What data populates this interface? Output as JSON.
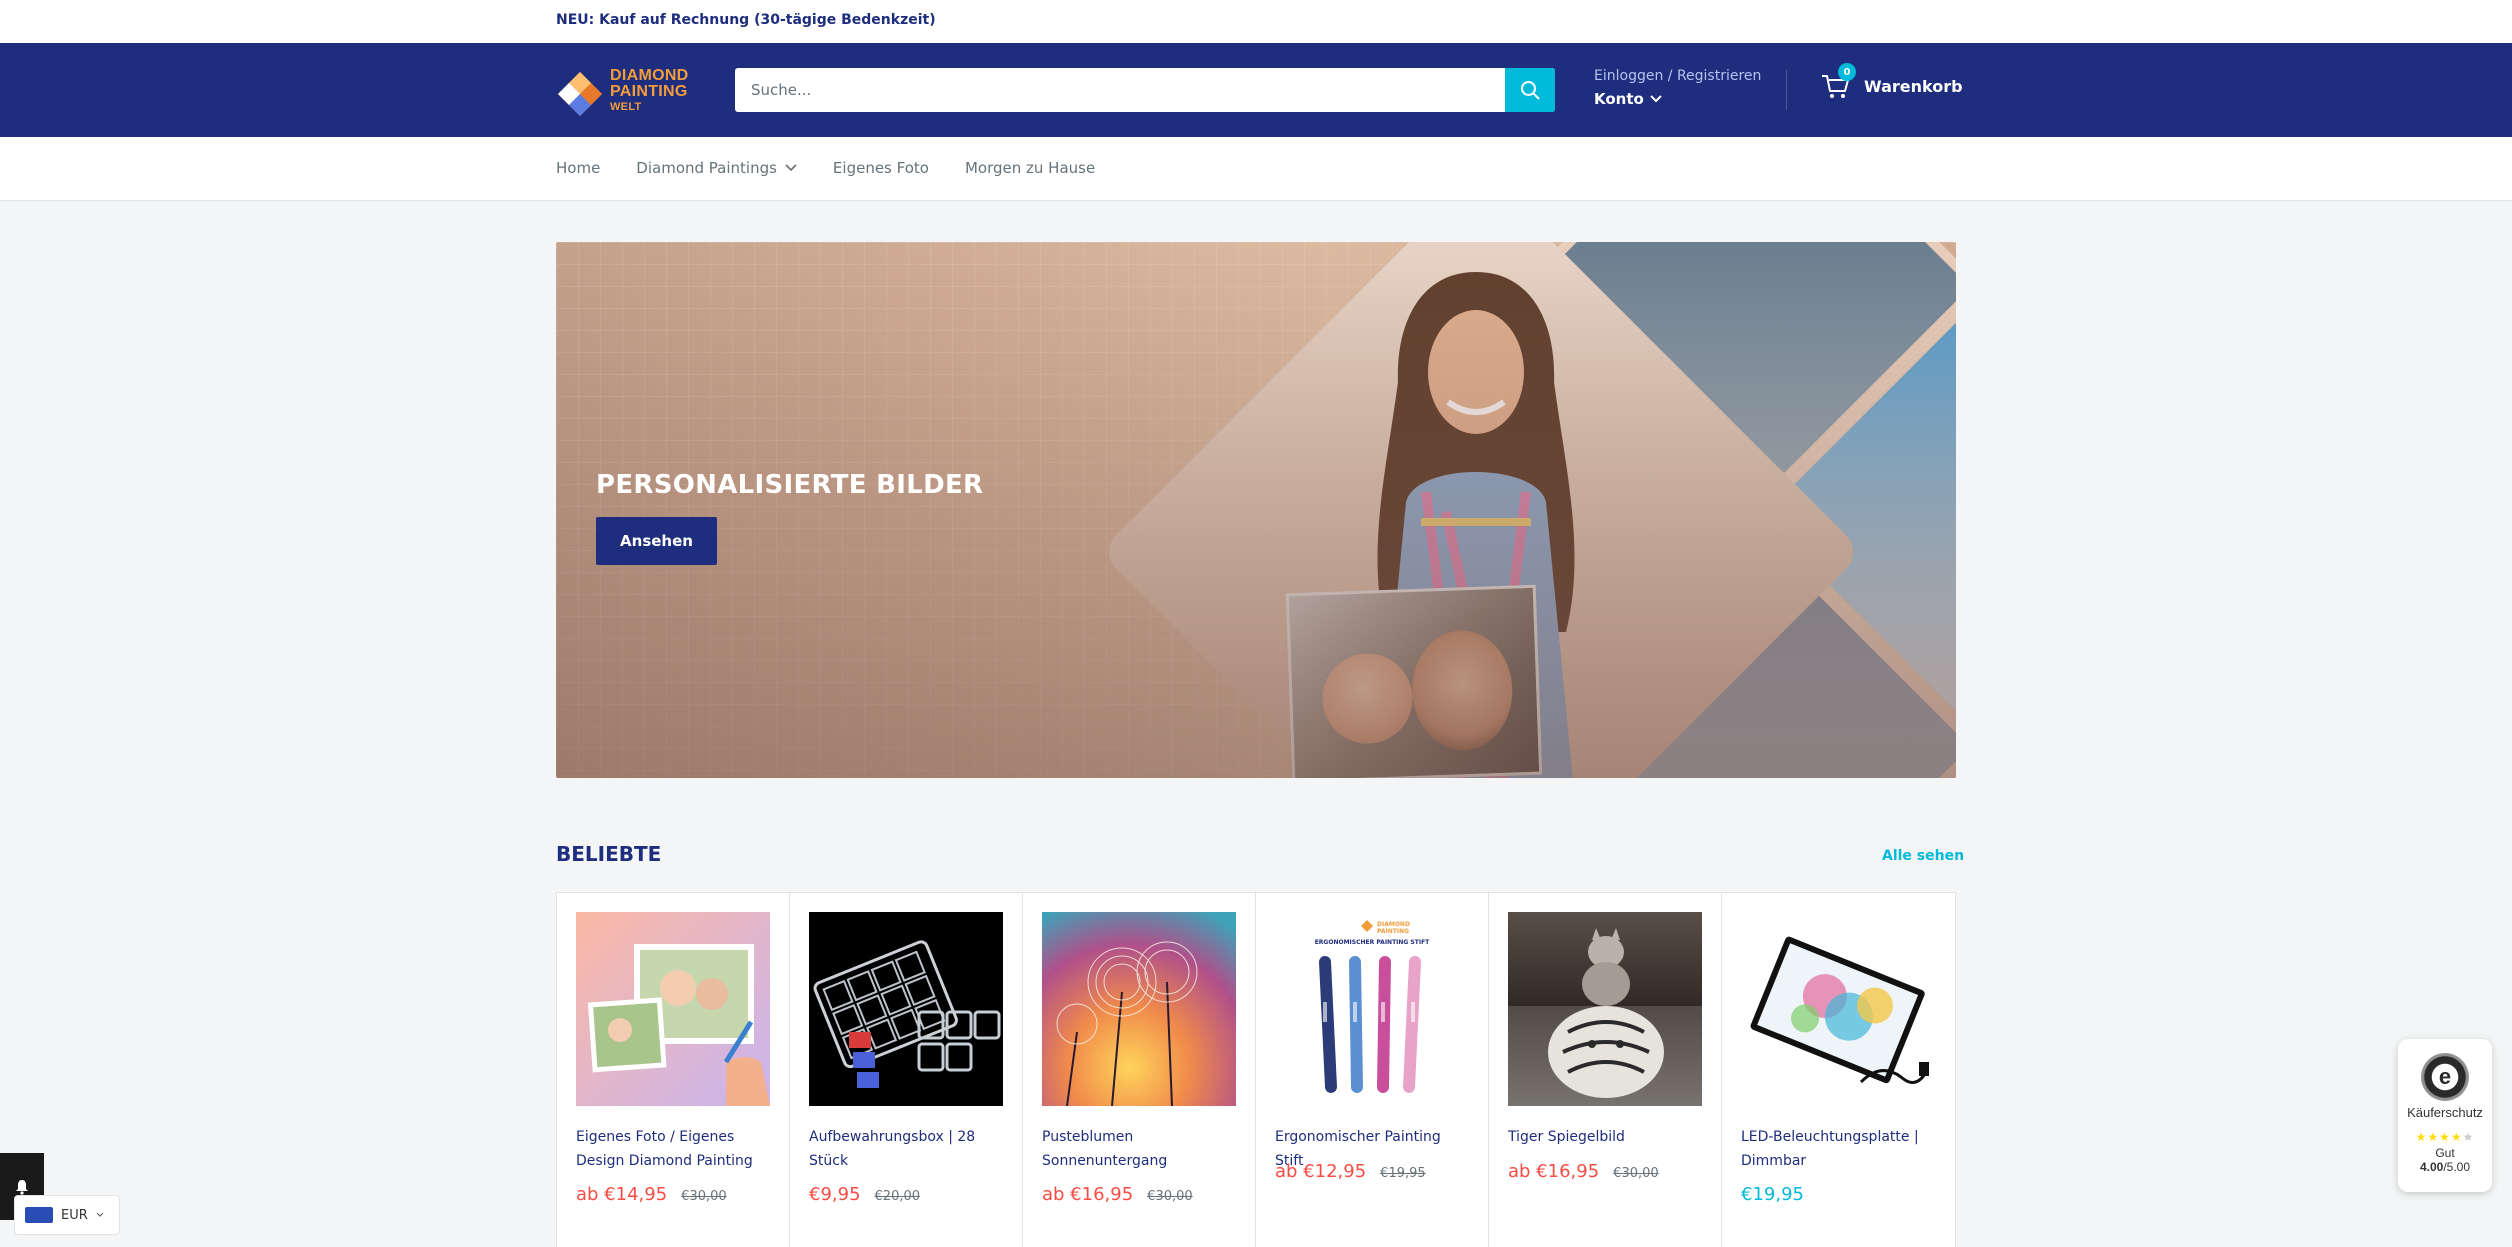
{
  "announcement": {
    "text": "NEU: Kauf auf Rechnung (30-tägige Bedenkzeit)"
  },
  "header": {
    "logo_line1": "DIAMOND",
    "logo_line2": "PAINTING",
    "logo_line3": "WELT",
    "search_placeholder": "Suche...",
    "account_link": "Einloggen / Registrieren",
    "account_label": "Konto",
    "cart_count": "0",
    "cart_label": "Warenkorb"
  },
  "nav": {
    "items": [
      {
        "label": "Home"
      },
      {
        "label": "Diamond Paintings",
        "has_dropdown": true
      },
      {
        "label": "Eigenes Foto"
      },
      {
        "label": "Morgen zu Hause"
      }
    ]
  },
  "hero": {
    "title": "PERSONALISIERTE BILDER",
    "button": "Ansehen"
  },
  "section": {
    "title": "BELIEBTE",
    "see_all": "Alle sehen"
  },
  "products": [
    {
      "name": "Eigenes Foto / Eigenes Design Diamond Painting",
      "price": "ab €14,95",
      "old_price": "€30,00"
    },
    {
      "name": "Aufbewahrungsbox | 28 Stück",
      "price": "€9,95",
      "old_price": "€20,00"
    },
    {
      "name": "Pusteblumen Sonnenuntergang",
      "price": "ab €16,95",
      "old_price": "€30,00"
    },
    {
      "name": "Ergonomischer Painting Stift",
      "price": "ab €12,95",
      "old_price": "€19,95"
    },
    {
      "name": "Tiger Spiegelbild",
      "price": "ab €16,95",
      "old_price": "€30,00"
    },
    {
      "name": "LED-Beleuchtungsplatte | Dimmbar",
      "price": "€19,95",
      "old_price": ""
    }
  ],
  "product_image_caption": "ERGONOMISCHER PAINTING STIFT",
  "currency": {
    "code": "EUR"
  },
  "trust_badge": {
    "label": "Käuferschutz",
    "grade": "Gut",
    "score": "4.00",
    "max": "/5.00",
    "rating": 4
  },
  "colors": {
    "brand": "#1e2d7d",
    "accent": "#00badb",
    "sale": "#f94c43",
    "logo_orange": "#f29c3a"
  }
}
